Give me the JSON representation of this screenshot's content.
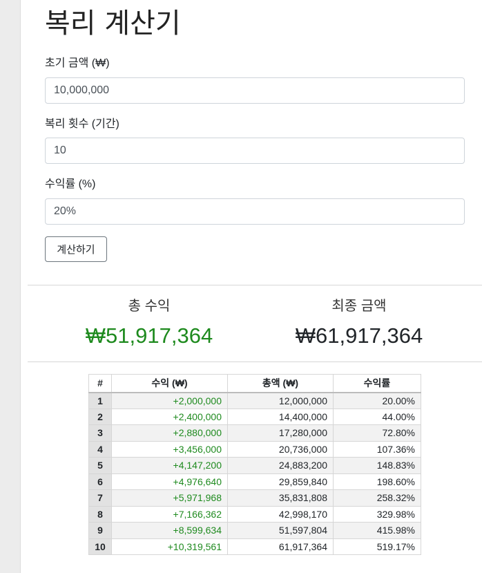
{
  "title": "복리 계산기",
  "form": {
    "principal_label": "초기 금액 (₩)",
    "principal_value": "10,000,000",
    "periods_label": "복리 횟수 (기간)",
    "periods_value": "10",
    "rate_label": "수익률 (%)",
    "rate_value": "20%",
    "submit_label": "계산하기"
  },
  "summary": {
    "total_profit_label": "총 수익",
    "total_profit_value": "₩51,917,364",
    "final_amount_label": "최종 금액",
    "final_amount_value": "₩61,917,364"
  },
  "table": {
    "headers": [
      "#",
      "수익 (₩)",
      "총액 (₩)",
      "수익률"
    ],
    "rows": [
      {
        "idx": "1",
        "profit": "+2,000,000",
        "total": "12,000,000",
        "rate": "20.00%"
      },
      {
        "idx": "2",
        "profit": "+2,400,000",
        "total": "14,400,000",
        "rate": "44.00%"
      },
      {
        "idx": "3",
        "profit": "+2,880,000",
        "total": "17,280,000",
        "rate": "72.80%"
      },
      {
        "idx": "4",
        "profit": "+3,456,000",
        "total": "20,736,000",
        "rate": "107.36%"
      },
      {
        "idx": "5",
        "profit": "+4,147,200",
        "total": "24,883,200",
        "rate": "148.83%"
      },
      {
        "idx": "6",
        "profit": "+4,976,640",
        "total": "29,859,840",
        "rate": "198.60%"
      },
      {
        "idx": "7",
        "profit": "+5,971,968",
        "total": "35,831,808",
        "rate": "258.32%"
      },
      {
        "idx": "8",
        "profit": "+7,166,362",
        "total": "42,998,170",
        "rate": "329.98%"
      },
      {
        "idx": "9",
        "profit": "+8,599,634",
        "total": "51,597,804",
        "rate": "415.98%"
      },
      {
        "idx": "10",
        "profit": "+10,319,561",
        "total": "61,917,364",
        "rate": "519.17%"
      }
    ]
  },
  "colors": {
    "positive": "#1e8a1e",
    "index_cell_bg": "#e2e2e2"
  }
}
